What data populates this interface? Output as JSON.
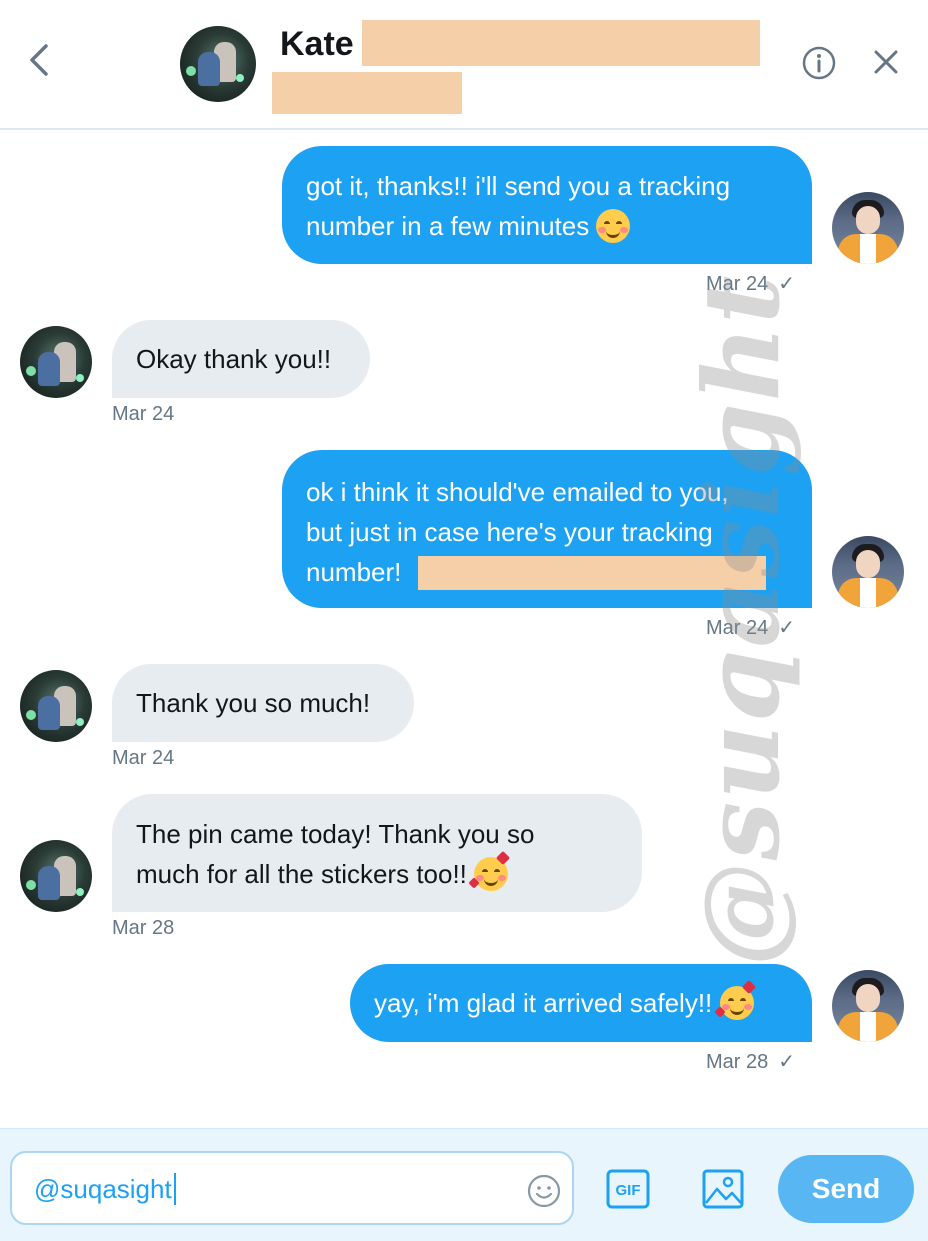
{
  "header": {
    "contact_name": "Kate",
    "back_icon": "chevron-left-icon",
    "info_icon": "info-icon",
    "close_icon": "close-icon"
  },
  "messages": [
    {
      "direction": "out",
      "text": "got it, thanks!! i'll send you a tracking\nnumber in a few minutes ",
      "emoji": "smiling-face-icon",
      "date": "Mar 24",
      "read": "✓"
    },
    {
      "direction": "in",
      "text": "Okay thank you!!",
      "date": "Mar 24"
    },
    {
      "direction": "out",
      "text": "ok i think it should've emailed to you,\nbut just in case here's your tracking\nnumber! ",
      "date": "Mar 24",
      "read": "✓"
    },
    {
      "direction": "in",
      "text": "Thank you so much!",
      "date": "Mar 24"
    },
    {
      "direction": "in",
      "text": "The pin came today! Thank you so\nmuch for all the stickers too!! ",
      "emoji": "smiling-face-with-hearts-icon",
      "date": "Mar 28"
    },
    {
      "direction": "out",
      "text": "yay, i'm glad it arrived safely!! ",
      "emoji": "smiling-face-with-hearts-icon",
      "date": "Mar 28",
      "read": "✓"
    }
  ],
  "watermark": "@suqasight",
  "composer": {
    "input_value": "@suqasight",
    "gif_label": "GIF",
    "send_label": "Send"
  },
  "colors": {
    "outgoing_bubble": "#1da1f2",
    "incoming_bubble": "#e6ecf0",
    "redaction": "#f5cfa8",
    "send_button": "#58b6f2",
    "composer_bg": "#e8f5fd"
  }
}
